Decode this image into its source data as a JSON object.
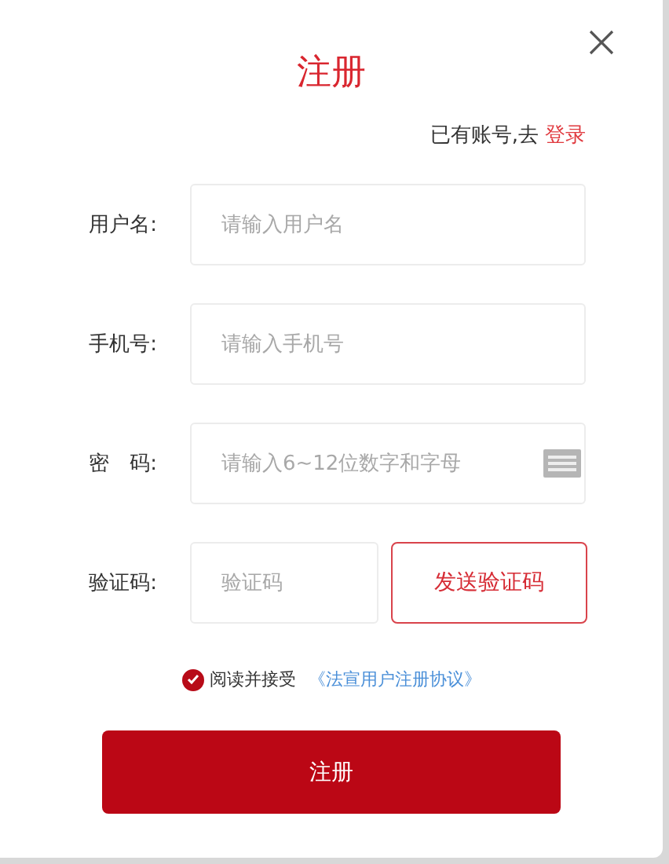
{
  "dialog": {
    "title": "注册",
    "login_prompt": "已有账号,去",
    "login_link": "登录"
  },
  "fields": [
    {
      "kind": "text",
      "label": "用户名:",
      "placeholder": "请输入用户名"
    },
    {
      "kind": "text",
      "label": "手机号:",
      "placeholder": "请输入手机号"
    },
    {
      "kind": "password",
      "label": "密　码:",
      "placeholder": "请输入6~12位数字和字母"
    },
    {
      "kind": "captcha",
      "label": "验证码:",
      "placeholder": "验证码",
      "button": "发送验证码"
    }
  ],
  "agreement": {
    "checked": true,
    "text": "阅读并接受",
    "link": "《法宣用户注册协议》"
  },
  "submit": "注册"
}
